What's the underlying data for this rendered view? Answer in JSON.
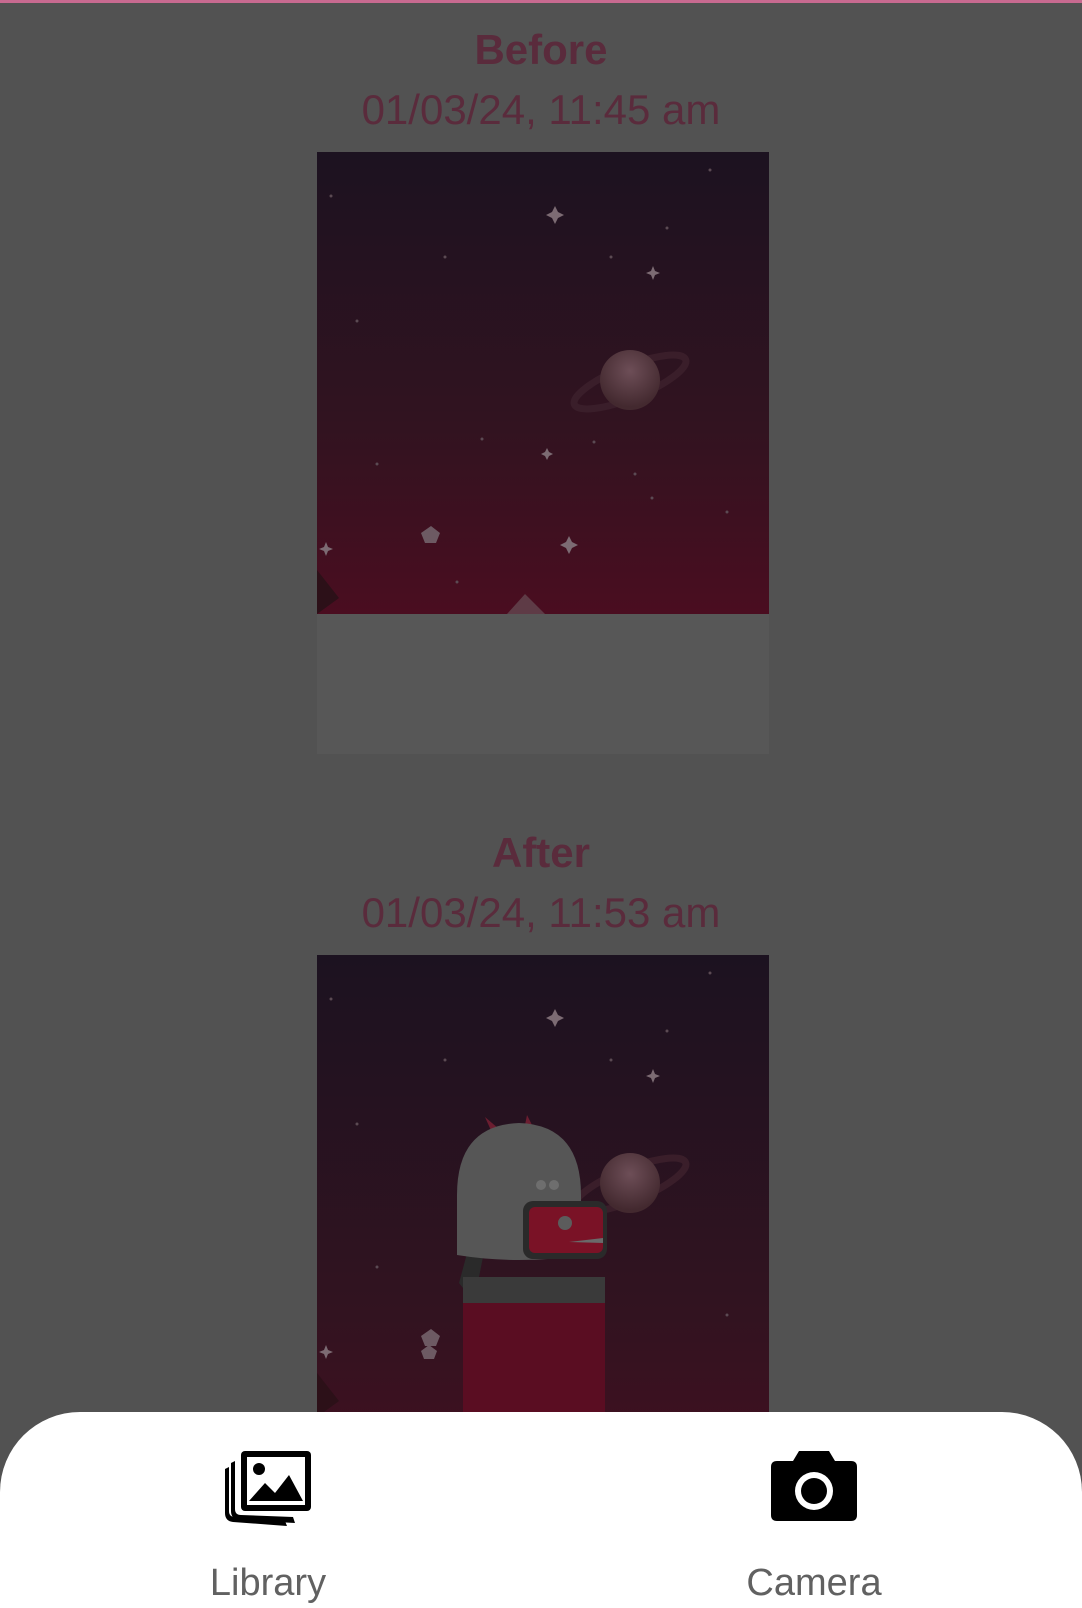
{
  "before": {
    "title": "Before",
    "date": "01/03/24, 11:45 am"
  },
  "after": {
    "title": "After",
    "date": "01/03/24, 11:53 am"
  },
  "sheet": {
    "options": [
      {
        "label": "Library",
        "icon": "photo-library-icon"
      },
      {
        "label": "Camera",
        "icon": "camera-icon"
      }
    ]
  },
  "colors": {
    "scrim": "#525252",
    "accent_text": "#5a2b3c",
    "sky_top": "#1c1220",
    "sky_bottom": "#4a0d20",
    "sheet_background": "#ffffff"
  }
}
